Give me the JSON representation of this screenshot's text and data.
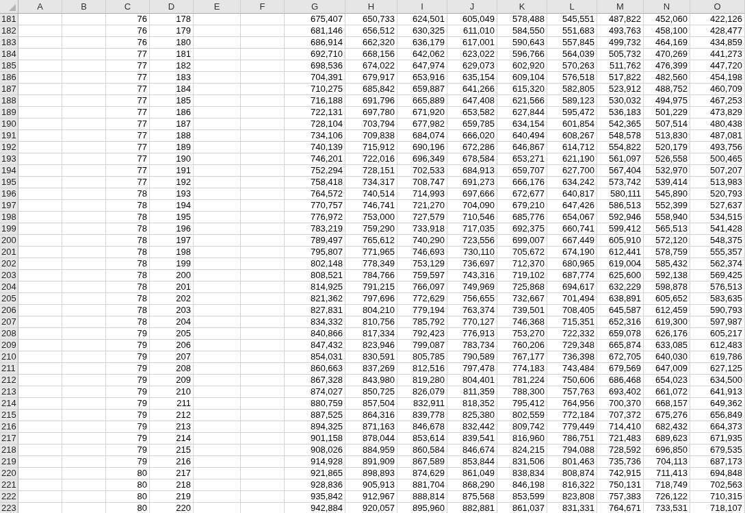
{
  "columns": [
    {
      "label": "A",
      "kind": "blank"
    },
    {
      "label": "B",
      "kind": "blank"
    },
    {
      "label": "C",
      "kind": "data"
    },
    {
      "label": "D",
      "kind": "data"
    },
    {
      "label": "E",
      "kind": "blank"
    },
    {
      "label": "F",
      "kind": "blank"
    },
    {
      "label": "G",
      "kind": "data"
    },
    {
      "label": "H",
      "kind": "data"
    },
    {
      "label": "I",
      "kind": "data"
    },
    {
      "label": "J",
      "kind": "data"
    },
    {
      "label": "K",
      "kind": "data"
    },
    {
      "label": "L",
      "kind": "data"
    },
    {
      "label": "M",
      "kind": "data"
    },
    {
      "label": "N",
      "kind": "data"
    },
    {
      "label": "O",
      "kind": "data"
    }
  ],
  "rows": [
    {
      "header": "181",
      "cells": [
        "76",
        "178",
        "675,407",
        "650,733",
        "624,501",
        "605,049",
        "578,488",
        "545,551",
        "487,822",
        "452,060",
        "422,126"
      ]
    },
    {
      "header": "182",
      "cells": [
        "76",
        "179",
        "681,146",
        "656,512",
        "630,325",
        "611,010",
        "584,550",
        "551,683",
        "493,763",
        "458,100",
        "428,477"
      ]
    },
    {
      "header": "183",
      "cells": [
        "76",
        "180",
        "686,914",
        "662,320",
        "636,179",
        "617,001",
        "590,643",
        "557,845",
        "499,732",
        "464,169",
        "434,859"
      ]
    },
    {
      "header": "184",
      "cells": [
        "77",
        "181",
        "692,710",
        "668,156",
        "642,062",
        "623,022",
        "596,766",
        "564,039",
        "505,732",
        "470,269",
        "441,273"
      ]
    },
    {
      "header": "185",
      "cells": [
        "77",
        "182",
        "698,536",
        "674,022",
        "647,974",
        "629,073",
        "602,920",
        "570,263",
        "511,762",
        "476,399",
        "447,720"
      ]
    },
    {
      "header": "186",
      "cells": [
        "77",
        "183",
        "704,391",
        "679,917",
        "653,916",
        "635,154",
        "609,104",
        "576,518",
        "517,822",
        "482,560",
        "454,198"
      ]
    },
    {
      "header": "187",
      "cells": [
        "77",
        "184",
        "710,275",
        "685,842",
        "659,887",
        "641,266",
        "615,320",
        "582,805",
        "523,912",
        "488,752",
        "460,709"
      ]
    },
    {
      "header": "188",
      "cells": [
        "77",
        "185",
        "716,188",
        "691,796",
        "665,889",
        "647,408",
        "621,566",
        "589,123",
        "530,032",
        "494,975",
        "467,253"
      ]
    },
    {
      "header": "189",
      "cells": [
        "77",
        "186",
        "722,131",
        "697,780",
        "671,920",
        "653,582",
        "627,844",
        "595,472",
        "536,183",
        "501,229",
        "473,829"
      ]
    },
    {
      "header": "190",
      "cells": [
        "77",
        "187",
        "728,104",
        "703,794",
        "677,982",
        "659,785",
        "634,154",
        "601,854",
        "542,365",
        "507,514",
        "480,438"
      ]
    },
    {
      "header": "191",
      "cells": [
        "77",
        "188",
        "734,106",
        "709,838",
        "684,074",
        "666,020",
        "640,494",
        "608,267",
        "548,578",
        "513,830",
        "487,081"
      ]
    },
    {
      "header": "192",
      "cells": [
        "77",
        "189",
        "740,139",
        "715,912",
        "690,196",
        "672,286",
        "646,867",
        "614,712",
        "554,822",
        "520,179",
        "493,756"
      ]
    },
    {
      "header": "193",
      "cells": [
        "77",
        "190",
        "746,201",
        "722,016",
        "696,349",
        "678,584",
        "653,271",
        "621,190",
        "561,097",
        "526,558",
        "500,465"
      ]
    },
    {
      "header": "194",
      "cells": [
        "77",
        "191",
        "752,294",
        "728,151",
        "702,533",
        "684,913",
        "659,707",
        "627,700",
        "567,404",
        "532,970",
        "507,207"
      ]
    },
    {
      "header": "195",
      "cells": [
        "77",
        "192",
        "758,418",
        "734,317",
        "708,747",
        "691,273",
        "666,176",
        "634,242",
        "573,742",
        "539,414",
        "513,983"
      ]
    },
    {
      "header": "196",
      "cells": [
        "78",
        "193",
        "764,572",
        "740,514",
        "714,993",
        "697,666",
        "672,677",
        "640,817",
        "580,111",
        "545,890",
        "520,793"
      ]
    },
    {
      "header": "197",
      "cells": [
        "78",
        "194",
        "770,757",
        "746,741",
        "721,270",
        "704,090",
        "679,210",
        "647,426",
        "586,513",
        "552,399",
        "527,637"
      ]
    },
    {
      "header": "198",
      "cells": [
        "78",
        "195",
        "776,972",
        "753,000",
        "727,579",
        "710,546",
        "685,776",
        "654,067",
        "592,946",
        "558,940",
        "534,515"
      ]
    },
    {
      "header": "199",
      "cells": [
        "78",
        "196",
        "783,219",
        "759,290",
        "733,918",
        "717,035",
        "692,375",
        "660,741",
        "599,412",
        "565,513",
        "541,428"
      ]
    },
    {
      "header": "200",
      "cells": [
        "78",
        "197",
        "789,497",
        "765,612",
        "740,290",
        "723,556",
        "699,007",
        "667,449",
        "605,910",
        "572,120",
        "548,375"
      ]
    },
    {
      "header": "201",
      "cells": [
        "78",
        "198",
        "795,807",
        "771,965",
        "746,693",
        "730,110",
        "705,672",
        "674,190",
        "612,441",
        "578,759",
        "555,357"
      ]
    },
    {
      "header": "202",
      "cells": [
        "78",
        "199",
        "802,148",
        "778,349",
        "753,129",
        "736,697",
        "712,370",
        "680,965",
        "619,004",
        "585,432",
        "562,374"
      ]
    },
    {
      "header": "203",
      "cells": [
        "78",
        "200",
        "808,521",
        "784,766",
        "759,597",
        "743,316",
        "719,102",
        "687,774",
        "625,600",
        "592,138",
        "569,425"
      ]
    },
    {
      "header": "204",
      "cells": [
        "78",
        "201",
        "814,925",
        "791,215",
        "766,097",
        "749,969",
        "725,868",
        "694,617",
        "632,229",
        "598,878",
        "576,513"
      ]
    },
    {
      "header": "205",
      "cells": [
        "78",
        "202",
        "821,362",
        "797,696",
        "772,629",
        "756,655",
        "732,667",
        "701,494",
        "638,891",
        "605,652",
        "583,635"
      ]
    },
    {
      "header": "206",
      "cells": [
        "78",
        "203",
        "827,831",
        "804,210",
        "779,194",
        "763,374",
        "739,501",
        "708,405",
        "645,587",
        "612,459",
        "590,793"
      ]
    },
    {
      "header": "207",
      "cells": [
        "78",
        "204",
        "834,332",
        "810,756",
        "785,792",
        "770,127",
        "746,368",
        "715,351",
        "652,316",
        "619,300",
        "597,987"
      ]
    },
    {
      "header": "208",
      "cells": [
        "79",
        "205",
        "840,866",
        "817,334",
        "792,423",
        "776,913",
        "753,270",
        "722,332",
        "659,078",
        "626,176",
        "605,217"
      ]
    },
    {
      "header": "209",
      "cells": [
        "79",
        "206",
        "847,432",
        "823,946",
        "799,087",
        "783,734",
        "760,206",
        "729,348",
        "665,874",
        "633,085",
        "612,483"
      ]
    },
    {
      "header": "210",
      "cells": [
        "79",
        "207",
        "854,031",
        "830,591",
        "805,785",
        "790,589",
        "767,177",
        "736,398",
        "672,705",
        "640,030",
        "619,786"
      ]
    },
    {
      "header": "211",
      "cells": [
        "79",
        "208",
        "860,663",
        "837,269",
        "812,516",
        "797,478",
        "774,183",
        "743,484",
        "679,569",
        "647,009",
        "627,125"
      ]
    },
    {
      "header": "212",
      "cells": [
        "79",
        "209",
        "867,328",
        "843,980",
        "819,280",
        "804,401",
        "781,224",
        "750,606",
        "686,468",
        "654,023",
        "634,500"
      ]
    },
    {
      "header": "213",
      "cells": [
        "79",
        "210",
        "874,027",
        "850,725",
        "826,079",
        "811,359",
        "788,300",
        "757,763",
        "693,402",
        "661,072",
        "641,913"
      ]
    },
    {
      "header": "214",
      "cells": [
        "79",
        "211",
        "880,759",
        "857,504",
        "832,911",
        "818,352",
        "795,412",
        "764,956",
        "700,370",
        "668,157",
        "649,362"
      ]
    },
    {
      "header": "215",
      "cells": [
        "79",
        "212",
        "887,525",
        "864,316",
        "839,778",
        "825,380",
        "802,559",
        "772,184",
        "707,372",
        "675,276",
        "656,849"
      ]
    },
    {
      "header": "216",
      "cells": [
        "79",
        "213",
        "894,325",
        "871,163",
        "846,678",
        "832,442",
        "809,742",
        "779,449",
        "714,410",
        "682,432",
        "664,373"
      ]
    },
    {
      "header": "217",
      "cells": [
        "79",
        "214",
        "901,158",
        "878,044",
        "853,614",
        "839,541",
        "816,960",
        "786,751",
        "721,483",
        "689,623",
        "671,935"
      ]
    },
    {
      "header": "218",
      "cells": [
        "79",
        "215",
        "908,026",
        "884,959",
        "860,584",
        "846,674",
        "824,215",
        "794,088",
        "728,592",
        "696,850",
        "679,535"
      ]
    },
    {
      "header": "219",
      "cells": [
        "79",
        "216",
        "914,928",
        "891,909",
        "867,589",
        "853,844",
        "831,506",
        "801,463",
        "735,736",
        "704,113",
        "687,173"
      ]
    },
    {
      "header": "220",
      "cells": [
        "80",
        "217",
        "921,865",
        "898,893",
        "874,629",
        "861,049",
        "838,834",
        "808,874",
        "742,915",
        "711,413",
        "694,848"
      ]
    },
    {
      "header": "221",
      "cells": [
        "80",
        "218",
        "928,836",
        "905,913",
        "881,704",
        "868,290",
        "846,198",
        "816,322",
        "750,131",
        "718,749",
        "702,563"
      ]
    },
    {
      "header": "222",
      "cells": [
        "80",
        "219",
        "935,842",
        "912,967",
        "888,814",
        "875,568",
        "853,599",
        "823,808",
        "757,383",
        "726,122",
        "710,315"
      ]
    },
    {
      "header": "223",
      "cells": [
        "80",
        "220",
        "942,884",
        "920,057",
        "895,960",
        "882,881",
        "861,037",
        "831,331",
        "764,671",
        "733,531",
        "718,107"
      ]
    }
  ]
}
